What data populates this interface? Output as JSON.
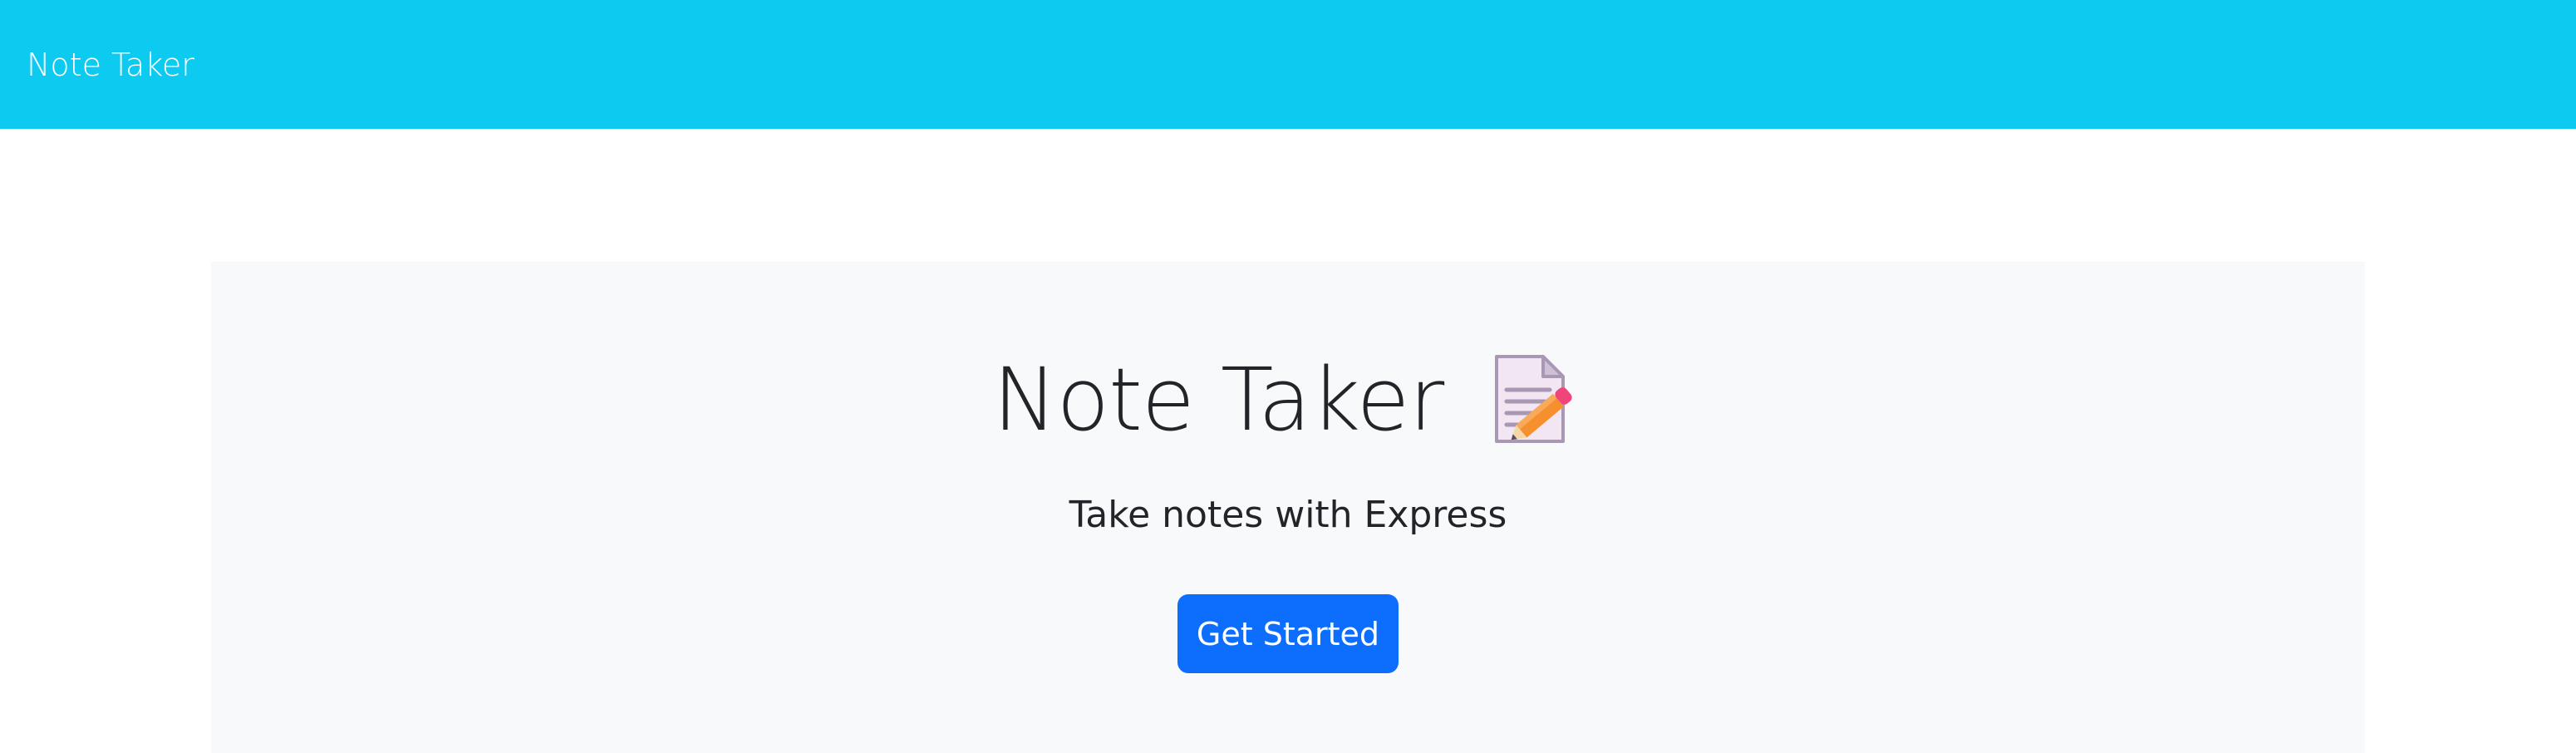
{
  "navbar": {
    "brand": "Note Taker"
  },
  "hero": {
    "title": "Note Taker",
    "icon": "memo-icon",
    "subtitle": "Take notes with Express",
    "button_label": "Get Started"
  },
  "colors": {
    "navbar_bg": "#0dcaf0",
    "jumbotron_bg": "#f8f9fa",
    "button_bg": "#0d6efd",
    "text": "#212529"
  }
}
